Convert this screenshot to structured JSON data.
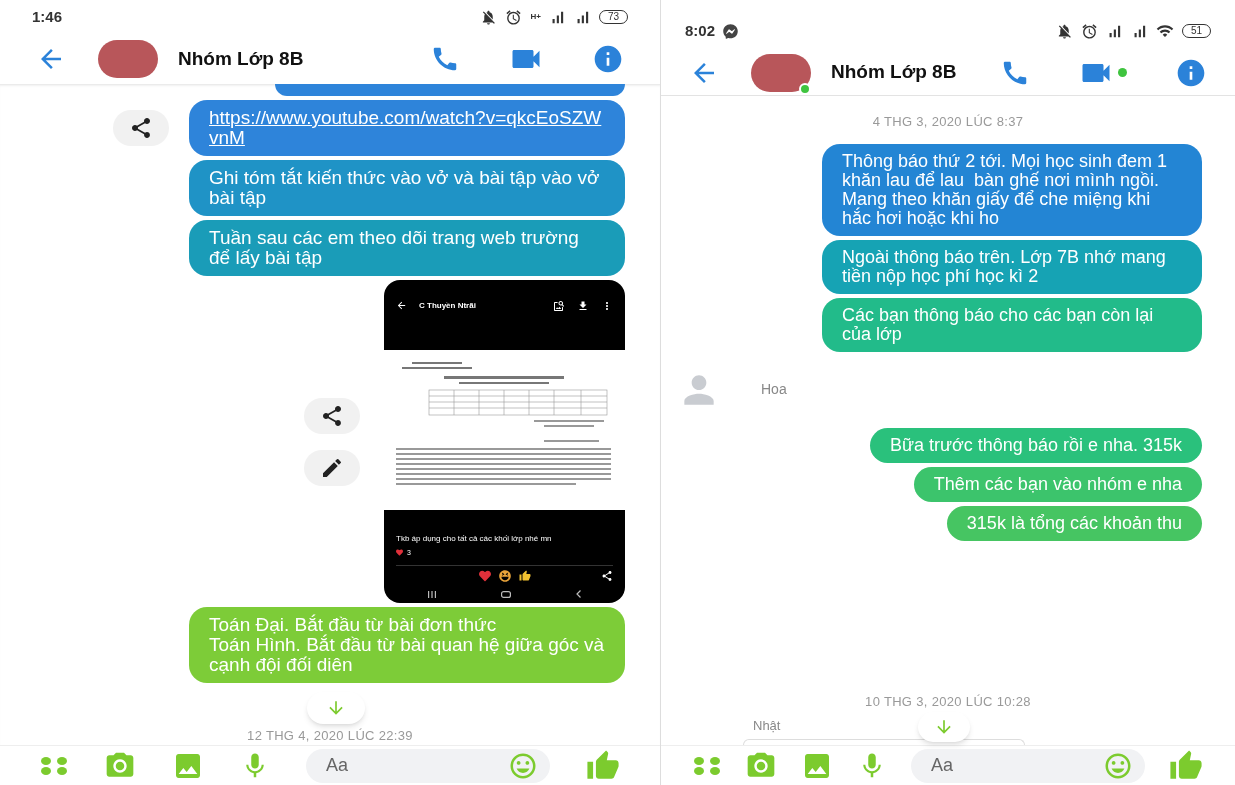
{
  "phones": [
    {
      "status_bar": {
        "time": "1:46",
        "network": "H+",
        "battery": "73"
      },
      "header": {
        "title": "Nhóm Lớp 8B"
      },
      "messages": [
        {
          "kind": "partial",
          "color": "#2e84da"
        },
        {
          "kind": "link",
          "text": "https://www.youtube.com/watch?v=qkcEoSZWvnM",
          "color": "#2e84da"
        },
        {
          "kind": "text",
          "text": "Ghi tóm tắt kiến thức vào vở và bài tập vào vở bài tập",
          "color": "#1f93c6"
        },
        {
          "kind": "text",
          "text": "Tuần sau các em theo dõi trang web trường để lấy bài tập",
          "color": "#1a9cb8"
        },
        {
          "kind": "image",
          "app_title": "C Thuyền Ntrãi",
          "caption": "Tkb áp dụng cho tất cả các khối lớp nhé mn",
          "reaction_count": "3"
        },
        {
          "kind": "text",
          "text": "Toán Đại. Bắt đầu từ bài đơn thức\nToán Hình. Bắt đầu từ bài quan hệ giữa góc và cạnh đội đối diên",
          "color": "#7dcc38"
        },
        {
          "kind": "timestamp",
          "text": "12 THG 4, 2020 LÚC 22:39"
        }
      ],
      "composer": {
        "placeholder": "Aa"
      }
    },
    {
      "status_bar": {
        "time": "8:02",
        "battery": "51",
        "messenger_notification": true,
        "wifi": true
      },
      "header": {
        "title": "Nhóm Lớp 8B",
        "online": true,
        "video_active": true
      },
      "messages": [
        {
          "kind": "timestamp",
          "text": "4 THG 3, 2020 LÚC 8:37"
        },
        {
          "kind": "text",
          "text": "Thông báo thứ 2 tới. Mọi học sinh đem 1 khăn lau để lau  bàn ghế nơi mình ngồi. Mang theo khăn giấy để che miệng khi hắc hơi hoặc khi ho",
          "color": "#2385d4"
        },
        {
          "kind": "text",
          "text": "Ngoài thông báo trên. Lớp 7B nhớ mang tiền nộp học phí học kì 2",
          "color": "#16a3b4"
        },
        {
          "kind": "text",
          "text": "Các bạn thông báo cho các bạn còn lại của lớp",
          "color": "#22bb8a"
        },
        {
          "kind": "sender",
          "text": "Hoa"
        },
        {
          "kind": "text",
          "text": "Bữa trước thông báo rồi e nha. 315k",
          "color": "#2ac17c"
        },
        {
          "kind": "text",
          "text": "Thêm các bạn vào nhóm e nha",
          "color": "#3cc46c"
        },
        {
          "kind": "text",
          "text": "315k là tổng các khoản thu",
          "color": "#46c562"
        },
        {
          "kind": "timestamp",
          "text": "10 THG 3, 2020 LÚC 10:28"
        },
        {
          "kind": "sender_plain",
          "text": "Nhật"
        },
        {
          "kind": "partial_incoming"
        }
      ],
      "composer": {
        "placeholder": "Aa"
      }
    }
  ]
}
